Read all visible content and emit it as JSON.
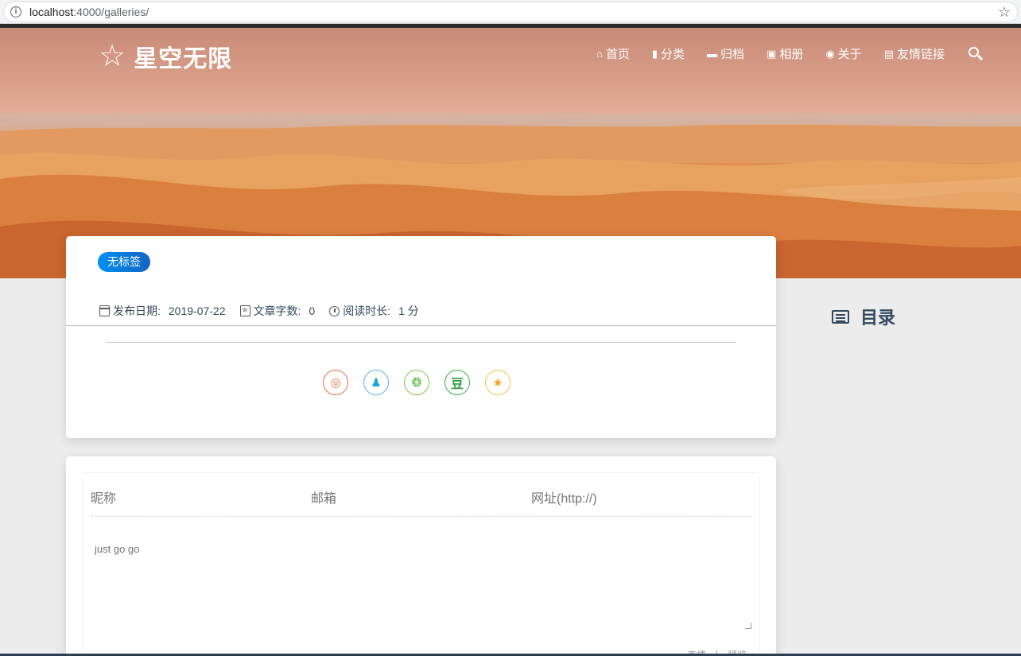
{
  "browser": {
    "url_host": "localhost",
    "url_path": ":4000/galleries/"
  },
  "brand": {
    "star": "☆",
    "title": "星空无限"
  },
  "nav": {
    "items": [
      {
        "icon": "home-icon",
        "glyph": "⌂",
        "label": "首页"
      },
      {
        "icon": "bookmark-icon",
        "glyph": "▮",
        "label": "分类"
      },
      {
        "icon": "archive-icon",
        "glyph": "▬",
        "label": "归档"
      },
      {
        "icon": "image-icon",
        "glyph": "▣",
        "label": "相册"
      },
      {
        "icon": "user-circle-icon",
        "glyph": "◉",
        "label": "关于"
      },
      {
        "icon": "address-card-icon",
        "glyph": "▤",
        "label": "友情链接"
      }
    ]
  },
  "article": {
    "tag": "无标签",
    "publish_label": "发布日期:",
    "publish_date": "2019-07-22",
    "words_label": "文章字数:",
    "words_value": "0",
    "read_label": "阅读时长:",
    "read_value": "1 分"
  },
  "share": {
    "buttons": [
      {
        "icon": "weibo-icon",
        "glyph": "◎"
      },
      {
        "icon": "qq-icon",
        "glyph": "♟"
      },
      {
        "icon": "wechat-icon",
        "glyph": "❂"
      },
      {
        "icon": "douban-icon",
        "glyph": "豆"
      },
      {
        "icon": "qzone-icon",
        "glyph": "★"
      }
    ]
  },
  "toc": {
    "title": "目录"
  },
  "comment": {
    "nick_placeholder": "昵称",
    "mail_placeholder": "邮箱",
    "url_placeholder": "网址(http://)",
    "text_placeholder": "just go go",
    "emoji_label": "表情",
    "separator": "|",
    "preview_label": "预览"
  },
  "colors": {
    "accent": "#0090f5",
    "text": "#34495e"
  }
}
